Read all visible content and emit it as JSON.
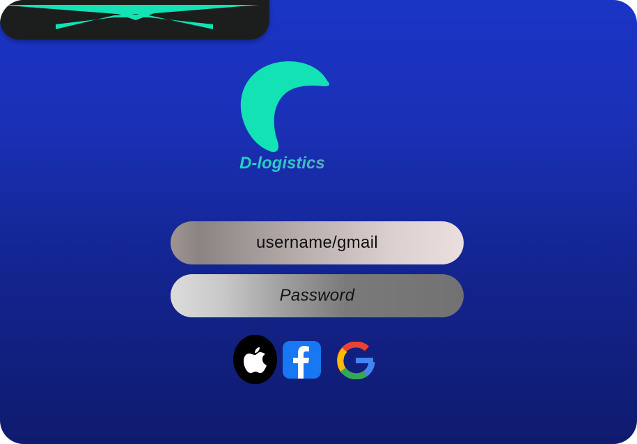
{
  "brand": {
    "name": "D-logistics",
    "logo_icon": "crescent-logo-icon",
    "accent_color": "#12e2b4"
  },
  "header": {
    "menu_icon": "close-x-icon"
  },
  "login": {
    "username_text": "username/gmail",
    "password_text": "Password"
  },
  "social_logins": [
    {
      "icon": "apple-icon",
      "color": "#000000"
    },
    {
      "icon": "facebook-icon",
      "color": "#1877f2"
    },
    {
      "icon": "google-icon",
      "color": "#4285f4"
    }
  ],
  "colors": {
    "background_top": "#1a34c6",
    "background_bottom": "#0f1b6e",
    "top_bar": "#1b1e1c"
  }
}
